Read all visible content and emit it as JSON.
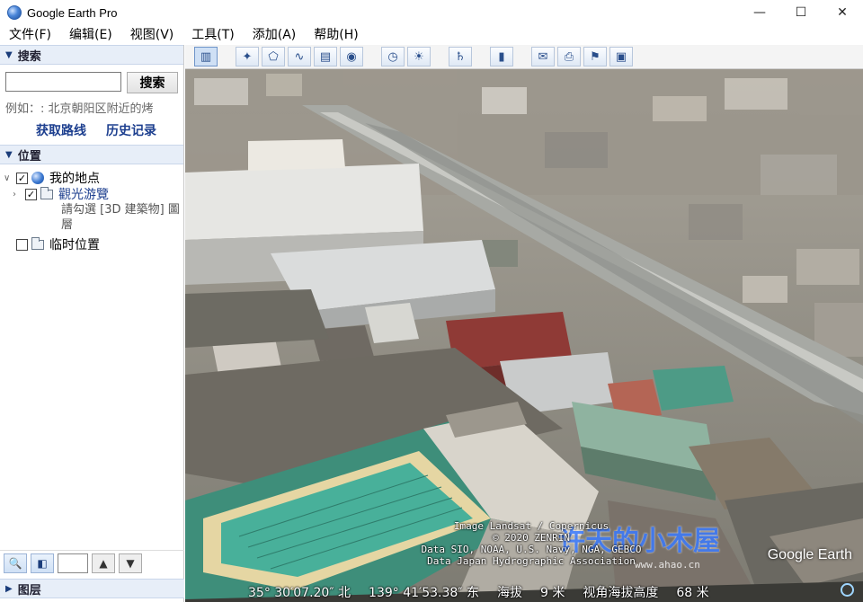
{
  "window": {
    "title": "Google Earth Pro"
  },
  "menu": [
    "文件(F)",
    "编辑(E)",
    "视图(V)",
    "工具(T)",
    "添加(A)",
    "帮助(H)"
  ],
  "search": {
    "header": "搜索",
    "button": "搜索",
    "input_value": "",
    "example": "例如：: 北京朝阳区附近的烤",
    "links": {
      "route": "获取路线",
      "history": "历史记录"
    }
  },
  "places": {
    "header": "位置",
    "my_places": "我的地点",
    "folder1": "觀光游覽",
    "folder1_desc": "請勾選 [3D 建築物] 圖層",
    "temp": "临时位置",
    "check": "✓"
  },
  "layers": {
    "header": "图层"
  },
  "viewport": {
    "attribution": [
      "Image Landsat / Copernicus",
      "© 2020 ZENRIN",
      "Data SIO, NOAA, U.S. Navy, NGA, GEBCO",
      "Data Japan Hydrographic Association"
    ],
    "brand": "Google Earth",
    "watermark": "许天的小木屋",
    "watermark_sub": "www.ahao.cn",
    "status": {
      "lat": "35° 30′07.20″ 北",
      "lon": "139° 41′53.38″ 东",
      "elev_label": "海拔",
      "elev_value": "9 米",
      "eye_label": "视角海拔高度",
      "eye_value": "68 米"
    }
  },
  "colors": {
    "accent": "#1d3f8f",
    "header_bg": "#e7eef8",
    "pool": "#3fa58a"
  }
}
